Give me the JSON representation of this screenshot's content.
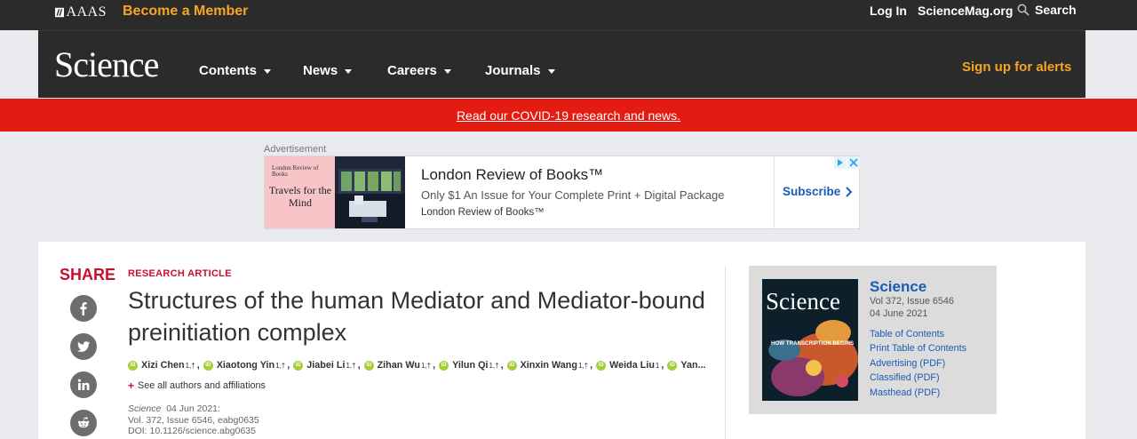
{
  "topbar": {
    "org": "AAAS",
    "member_label": "Become a Member",
    "login_label": "Log In",
    "site_label": "ScienceMag.org",
    "search_label": "Search"
  },
  "nav": {
    "wordmark": "Science",
    "items": [
      {
        "label": "Contents"
      },
      {
        "label": "News"
      },
      {
        "label": "Careers"
      },
      {
        "label": "Journals"
      }
    ],
    "alerts_label": "Sign up for alerts"
  },
  "banner": {
    "text": "Read our COVID-19 research and news."
  },
  "ad": {
    "label": "Advertisement",
    "logo_text": "London Review of Books",
    "tagline": "Travels for the Mind",
    "title": "London Review of Books™",
    "description": "Only $1 An Issue for Your Complete Print + Digital Package",
    "brand": "London Review of Books™",
    "cta": "Subscribe"
  },
  "share": {
    "title": "SHARE",
    "buttons": [
      {
        "icon": "facebook-icon"
      },
      {
        "icon": "twitter-icon"
      },
      {
        "icon": "linkedin-icon"
      },
      {
        "icon": "reddit-icon"
      }
    ]
  },
  "article": {
    "kicker": "RESEARCH ARTICLE",
    "title": "Structures of the human Mediator and Mediator-bound preinitiation complex",
    "authors": [
      {
        "name": "Xizi Chen",
        "sup": "1,†"
      },
      {
        "name": "Xiaotong Yin",
        "sup": "1,†"
      },
      {
        "name": "Jiabei Li",
        "sup": "1,†"
      },
      {
        "name": "Zihan Wu",
        "sup": "1,†"
      },
      {
        "name": "Yilun Qi",
        "sup": "1,†"
      },
      {
        "name": "Xinxin Wang",
        "sup": "1,†"
      },
      {
        "name": "Weida Liu",
        "sup": "1"
      },
      {
        "name": "Yan...",
        "sup": ""
      }
    ],
    "see_all": "See all authors and affiliations",
    "journal": "Science",
    "date": "04 Jun 2021:",
    "volume": "Vol. 372, Issue 6546, eabg0635",
    "doi": "DOI: 10.1126/science.abg0635"
  },
  "issue": {
    "title": "Science",
    "volume": "Vol 372, Issue 6546",
    "date": "04 June 2021",
    "cover_title": "Science",
    "cover_headline": "HOW TRANSCRIPTION BEGINS",
    "links": [
      {
        "label": "Table of Contents"
      },
      {
        "label": "Print Table of Contents"
      },
      {
        "label": "Advertising (PDF)"
      },
      {
        "label": "Classified (PDF)"
      },
      {
        "label": "Masthead (PDF)"
      }
    ]
  },
  "colors": {
    "accent_orange": "#f5a623",
    "covid_red": "#e41b13",
    "science_red": "#c8102e",
    "link_blue": "#1a5bb5"
  }
}
